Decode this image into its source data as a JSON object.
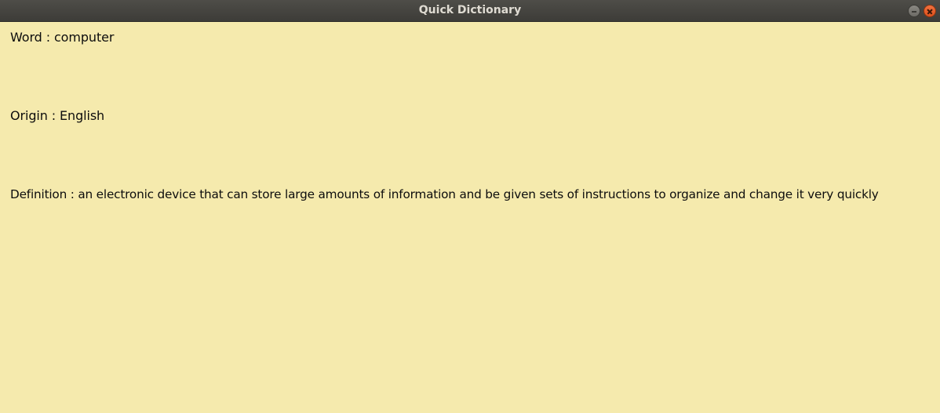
{
  "window": {
    "title": "Quick Dictionary",
    "controls": {
      "minimize_icon": "minimize-icon",
      "close_icon": "close-icon"
    },
    "background_color": "#f5eaad",
    "titlebar_color": "#3d3c38",
    "close_color": "#e0521d"
  },
  "entry": {
    "word_line": "Word : computer",
    "origin_line": "Origin : English",
    "definition_line": "Definition : an electronic device that can store large amounts of information and be given sets of instructions to organize and change it very quickly"
  }
}
